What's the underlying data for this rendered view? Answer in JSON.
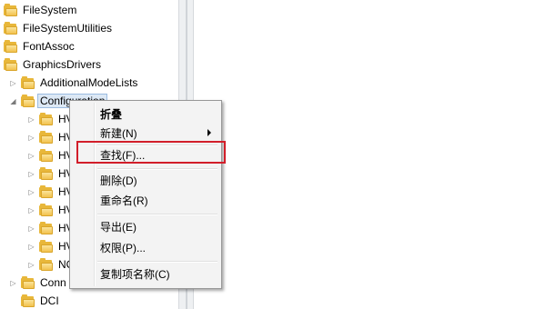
{
  "tree": {
    "items": [
      {
        "label": "FileSystem"
      },
      {
        "label": "FileSystemUtilities"
      },
      {
        "label": "FontAssoc"
      },
      {
        "label": "GraphicsDrivers"
      },
      {
        "label": "AdditionalModeLists"
      },
      {
        "label": "Configuration"
      },
      {
        "label": "HV"
      },
      {
        "label": "HV"
      },
      {
        "label": "HV"
      },
      {
        "label": "HV"
      },
      {
        "label": "HV"
      },
      {
        "label": "HV"
      },
      {
        "label": "HV"
      },
      {
        "label": "HV"
      },
      {
        "label": "NC"
      },
      {
        "label": "Conn"
      },
      {
        "label": "DCI"
      }
    ]
  },
  "context_menu": {
    "collapse": "折叠",
    "new": "新建(N)",
    "find": "查找(F)...",
    "delete": "删除(D)",
    "rename": "重命名(R)",
    "export": "导出(E)",
    "permissions": "权限(P)...",
    "copy_key_name": "复制项名称(C)"
  },
  "colors": {
    "highlight_border": "#d21e2a",
    "folder": "#e8b73a"
  }
}
